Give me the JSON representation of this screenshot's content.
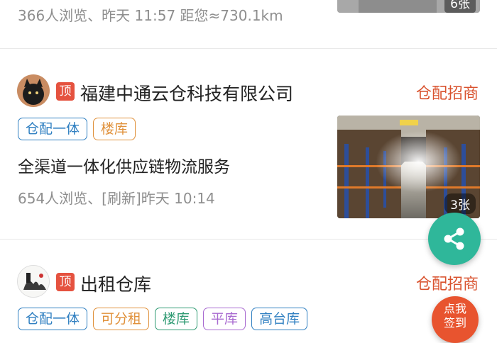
{
  "listings": [
    {
      "meta": "366人浏览、昨天 11:57  距您≈730.1km",
      "photo_count": "6张"
    },
    {
      "top_badge": "顶",
      "company": "福建中通云仓科技有限公司",
      "category": "仓配招商",
      "tags": [
        {
          "label": "仓配一体",
          "color": "#2f7fc1"
        },
        {
          "label": "楼库",
          "color": "#e0913b"
        }
      ],
      "title": "全渠道一体化供应链物流服务",
      "meta": "654人浏览、[刷新]昨天 10:14",
      "photo_count": "3张"
    },
    {
      "top_badge": "顶",
      "company": "出租仓库",
      "category": "仓配招商",
      "tags": [
        {
          "label": "仓配一体",
          "color": "#2f7fc1"
        },
        {
          "label": "可分租",
          "color": "#e0913b"
        },
        {
          "label": "楼库",
          "color": "#2e9a72"
        },
        {
          "label": "平库",
          "color": "#a86ad0"
        },
        {
          "label": "高台库",
          "color": "#2f7fc1"
        }
      ]
    }
  ],
  "fab": {
    "share_icon": "share-icon",
    "signin_line1": "点我",
    "signin_line2": "签到"
  }
}
